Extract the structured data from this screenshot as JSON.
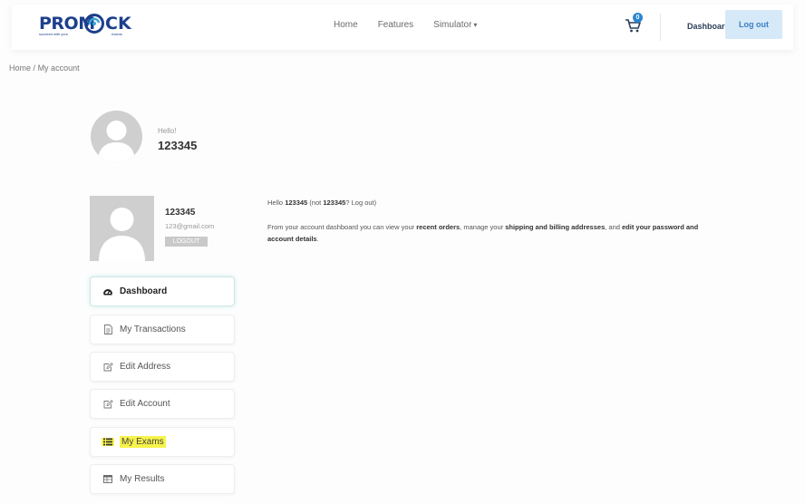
{
  "logo": {
    "brand_left": "PROM",
    "brand_right": "CK",
    "tagline_left": "succeed with your",
    "tagline_right": "exams"
  },
  "nav": {
    "home": "Home",
    "features": "Features",
    "simulator": "Simulator",
    "simulator_caret": "▾"
  },
  "cart": {
    "count": "0"
  },
  "header": {
    "dashboard": "Dashboard",
    "logout": "Log out"
  },
  "breadcrumb": {
    "home": "Home",
    "sep": "/",
    "current": "My account"
  },
  "greeting": {
    "hello": "Hello!",
    "username": "123345"
  },
  "profile": {
    "username": "123345",
    "email": "123@gmail.com",
    "logout": "LOGOUT"
  },
  "menu": [
    {
      "label": "Dashboard",
      "icon": "dashboard-icon",
      "active": true
    },
    {
      "label": "My Transactions",
      "icon": "document-icon"
    },
    {
      "label": "Edit Address",
      "icon": "edit-icon"
    },
    {
      "label": "Edit Account",
      "icon": "edit-icon"
    },
    {
      "label": "My Exams",
      "icon": "list-icon",
      "highlighted": true
    },
    {
      "label": "My Results",
      "icon": "table-icon"
    }
  ],
  "content": {
    "hello_pre": "Hello ",
    "hello_user": "123345",
    "hello_mid": " (not ",
    "hello_user2": "123345",
    "hello_q": "? ",
    "logout_link": "Log out",
    "hello_end": ")",
    "desc_1": "From your account dashboard you can view your ",
    "recent_orders": "recent orders",
    "desc_2": ", manage your ",
    "addresses": "shipping and billing addresses",
    "desc_3": ", and ",
    "edit_details": "edit your password and account details",
    "desc_4": "."
  },
  "colors": {
    "brand": "#1d3f8c",
    "accent": "#2a86d1",
    "logout_bg": "#d6e9f8",
    "highlight": "#f7f34b"
  }
}
